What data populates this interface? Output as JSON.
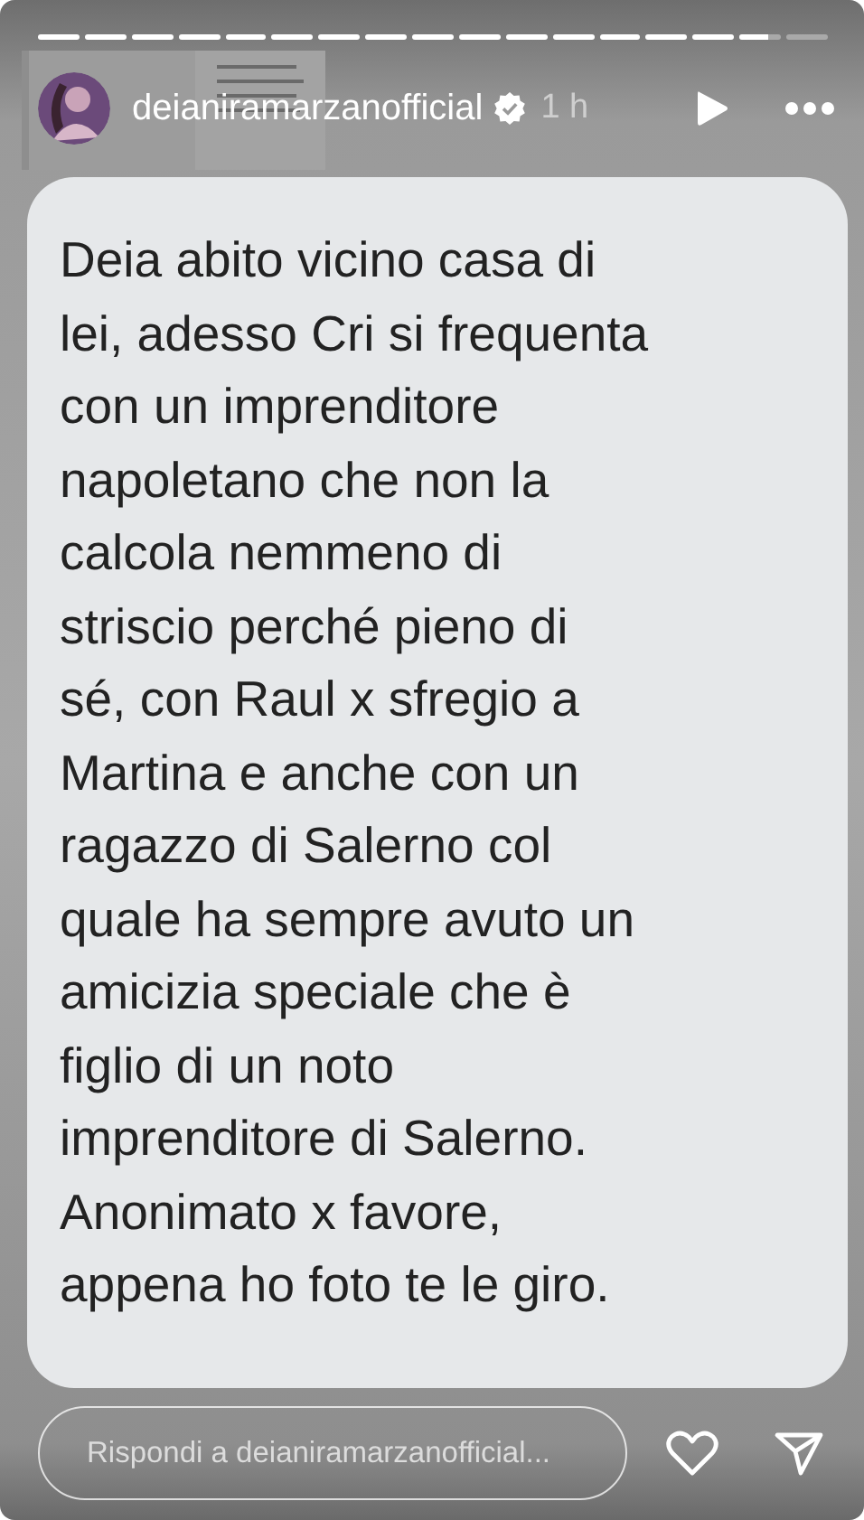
{
  "progress": [
    {
      "kind": "viewed"
    },
    {
      "kind": "viewed"
    },
    {
      "kind": "viewed"
    },
    {
      "kind": "viewed"
    },
    {
      "kind": "viewed"
    },
    {
      "kind": "viewed"
    },
    {
      "kind": "viewed"
    },
    {
      "kind": "viewed"
    },
    {
      "kind": "viewed"
    },
    {
      "kind": "viewed"
    },
    {
      "kind": "viewed"
    },
    {
      "kind": "viewed"
    },
    {
      "kind": "viewed"
    },
    {
      "kind": "viewed"
    },
    {
      "kind": "viewed"
    },
    {
      "kind": "current",
      "level": 0.7
    },
    {
      "kind": "upcoming"
    }
  ],
  "header": {
    "username": "deianiramarzanofficial",
    "verified": true,
    "time": "1 h"
  },
  "story_text": "Deia abito vicino casa di\nlei, adesso Cri si frequenta\ncon un imprenditore\nnapoletano che non la\ncalcola nemmeno di\nstriscio perché pieno di\nsé, con Raul x sfregio a\nMartina e anche con un\nragazzo di Salerno col\nquale ha sempre avuto un\namicizia speciale che è\nfiglio di un noto\nimprenditore di Salerno.\nAnonimato x favore,\nappena ho foto te le giro.",
  "reply": {
    "placeholder": "Rispondi a deianiramarzanofficial..."
  }
}
